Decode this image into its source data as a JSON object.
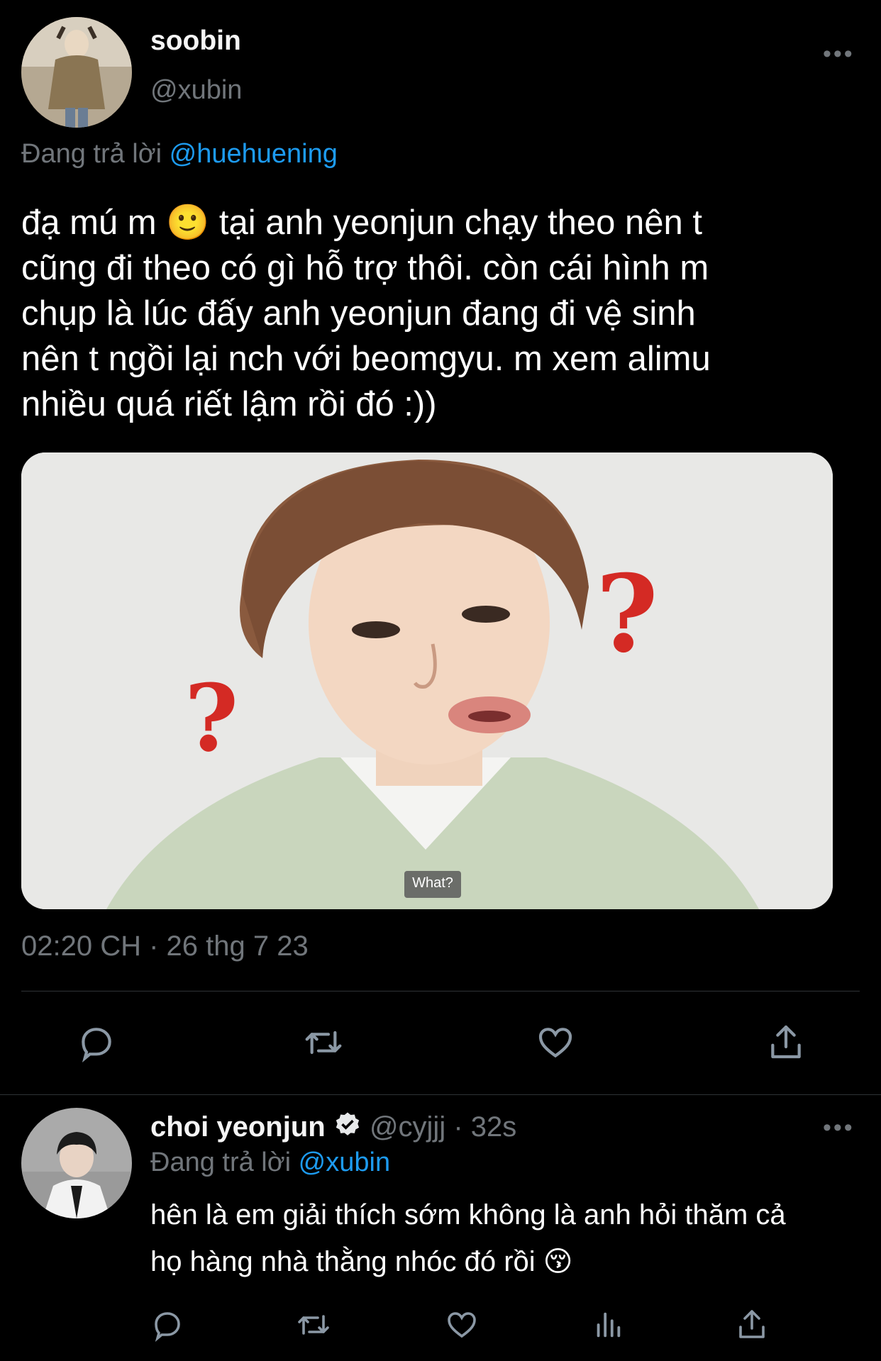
{
  "main_tweet": {
    "name": "soobin",
    "handle": "@xubin",
    "reply_prefix": "Đang trả lời",
    "reply_to": "@huehuening",
    "text_lines": [
      "đạ mú m 🙂 tại anh yeonjun chạy theo nên t",
      "cũng đi theo có gì hỗ trợ thôi. còn cái hình m",
      "chụp là lúc đấy anh yeonjun đang đi vệ sinh",
      "nên t ngồi lại nch với beomgyu. m xem alimu",
      "nhiều quá riết lậm rồi đó :))"
    ],
    "media_caption": "What?",
    "timestamp": "02:20 CH · 26 thg 7 23",
    "actions": [
      "reply-icon",
      "retweet-icon",
      "like-icon",
      "share-icon"
    ]
  },
  "reply_tweet": {
    "name": "choi yeonjun",
    "handle": "@cyjjj",
    "time": "· 32s",
    "verified": true,
    "reply_prefix": "Đang trả lời",
    "reply_to": "@xubin",
    "text_lines": [
      "hên là em giải thích sớm không là anh hỏi thăm cả",
      "họ hàng nhà thằng nhóc đó rồi 😚"
    ],
    "actions": [
      "reply-icon",
      "retweet-icon",
      "like-icon",
      "analytics-icon",
      "share-icon"
    ]
  },
  "colors": {
    "background": "#000000",
    "text": "#e7e9ea",
    "muted": "#71767b",
    "link": "#1d9bf0",
    "divider": "#2f3336"
  }
}
